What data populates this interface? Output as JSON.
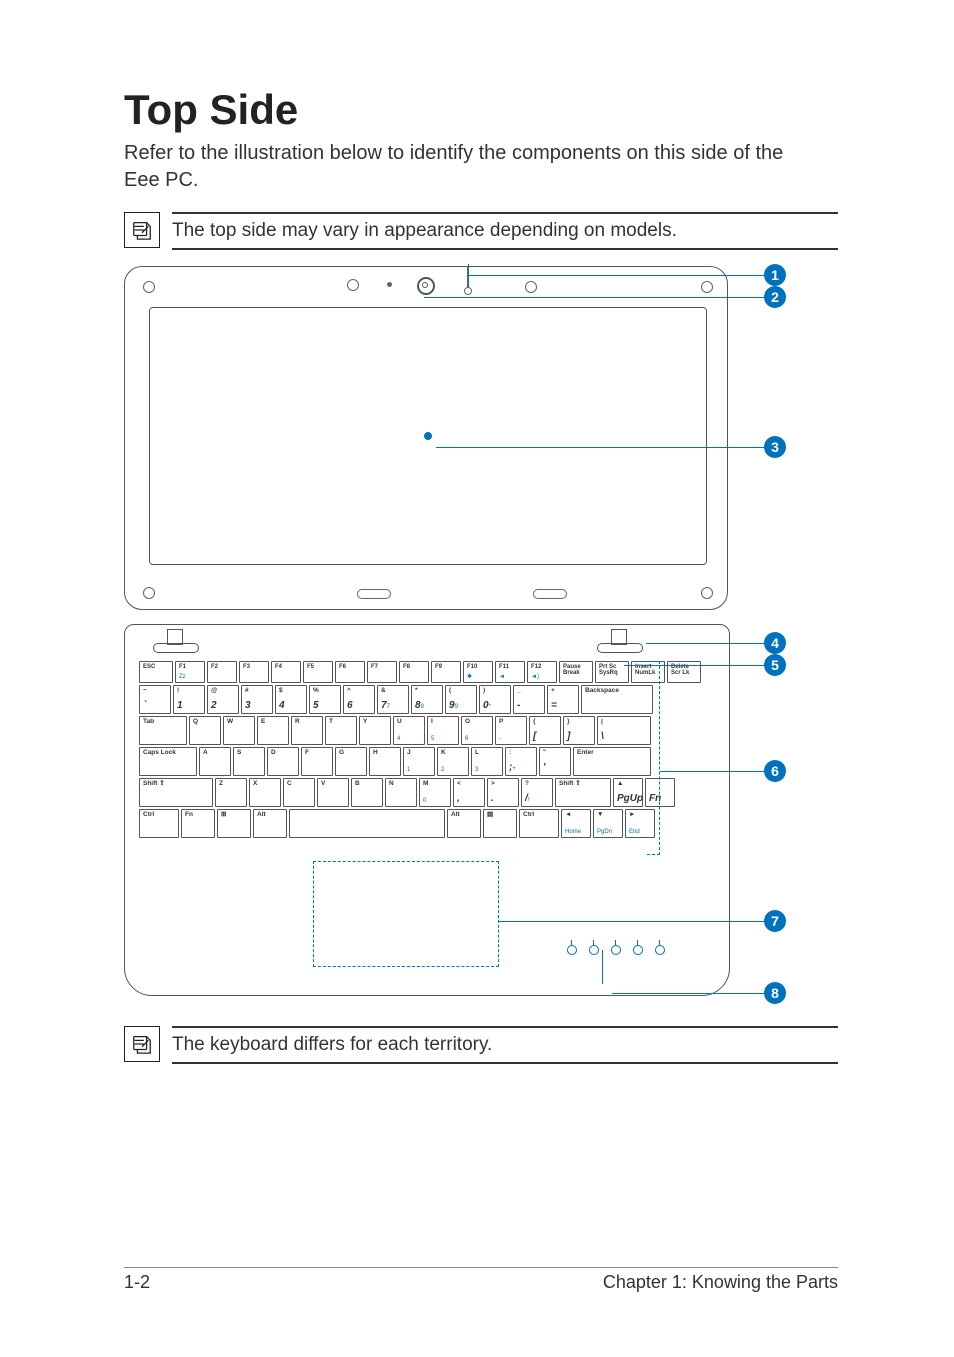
{
  "heading": "Top Side",
  "intro": "Refer to the illustration below to identify the components on this side of the Eee PC.",
  "note1": "The top side may vary in appearance depending on models.",
  "note2": "The keyboard differs for each territory.",
  "callouts": {
    "c1": "1",
    "c2": "2",
    "c3": "3",
    "c4": "4",
    "c5": "5",
    "c6": "6",
    "c7": "7",
    "c8": "8"
  },
  "keyboard": {
    "row_fn": [
      "ESC",
      "F1",
      "F2",
      "F3",
      "F4",
      "F5",
      "F6",
      "F7",
      "F8",
      "F9",
      "F10",
      "F11",
      "F12",
      "Pause Break",
      "Prt Sc SysRq",
      "Insert NumLk",
      "Delete Scr Lk"
    ],
    "row_fn_blue": [
      "",
      "Zz",
      "",
      "",
      "",
      "",
      "",
      "",
      "",
      "",
      "✱",
      "◄",
      "◄)",
      "",
      "",
      "",
      ""
    ],
    "row_num_top": [
      "~",
      "!",
      "@",
      "#",
      "$",
      "%",
      "^",
      "&",
      "*",
      "(",
      ")",
      "_",
      "+",
      "Backspace"
    ],
    "row_num_bot": [
      "`",
      "1",
      "2",
      "3",
      "4",
      "5",
      "6",
      "7",
      "8",
      "9",
      "0",
      "-",
      "=",
      ""
    ],
    "row_num_blue": [
      "",
      "",
      "",
      "",
      "",
      "",
      "",
      "7",
      "8",
      "9",
      "*",
      "",
      "",
      ""
    ],
    "row_q": [
      "Tab",
      "Q",
      "W",
      "E",
      "R",
      "T",
      "Y",
      "U",
      "I",
      "O",
      "P",
      "{",
      "}",
      "|"
    ],
    "row_q_bot": [
      "",
      "",
      "",
      "",
      "",
      "",
      "",
      "",
      "",
      "",
      "",
      "[",
      "]",
      "\\"
    ],
    "row_q_blue": [
      "",
      "",
      "",
      "",
      "",
      "",
      "",
      "4",
      "5",
      "6",
      "-",
      "",
      "",
      ""
    ],
    "row_a": [
      "Caps Lock",
      "A",
      "S",
      "D",
      "F",
      "G",
      "H",
      "J",
      "K",
      "L",
      ":",
      "\"",
      "Enter"
    ],
    "row_a_bot": [
      "",
      "",
      "",
      "",
      "",
      "",
      "",
      "",
      "",
      "",
      ";",
      "'",
      ""
    ],
    "row_a_blue": [
      "",
      "",
      "",
      "",
      "",
      "",
      "",
      "1",
      "2",
      "3",
      "+",
      "",
      ""
    ],
    "row_z": [
      "Shift ⇧",
      "Z",
      "X",
      "C",
      "V",
      "B",
      "N",
      "M",
      "<",
      ">",
      "?",
      "Shift ⇧",
      "▲",
      ""
    ],
    "row_z_bot": [
      "",
      "",
      "",
      "",
      "",
      "",
      "",
      "",
      ",",
      ".",
      "/",
      "",
      "PgUp",
      "Fn"
    ],
    "row_z_blue": [
      "",
      "",
      "",
      "",
      "",
      "",
      "",
      "0",
      "",
      "",
      "/",
      "",
      "",
      ""
    ],
    "row_ctrl": [
      "Ctrl",
      "Fn",
      "⊞",
      "Alt",
      "",
      "Alt",
      "▤",
      "Ctrl",
      "◄",
      "▼",
      "►"
    ],
    "row_ctrl_blue": [
      "",
      "",
      "",
      "",
      "",
      "",
      "",
      "",
      "Home",
      "PgDn",
      "End"
    ]
  },
  "footer": {
    "left": "1-2",
    "right": "Chapter 1: Knowing the Parts"
  }
}
